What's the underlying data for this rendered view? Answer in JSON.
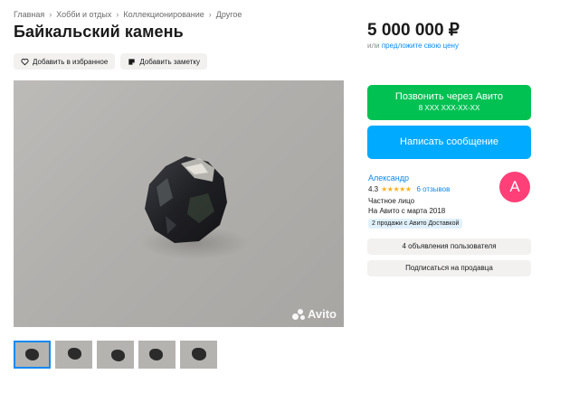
{
  "breadcrumb": [
    "Главная",
    "Хобби и отдых",
    "Коллекционирование",
    "Другое"
  ],
  "title": "Байкальский камень",
  "actions": {
    "favorite_label": "Добавить в избранное",
    "note_label": "Добавить заметку"
  },
  "price": {
    "value": "5 000 000 ₽",
    "or_label": "или",
    "offer_link": "предложите свою цену"
  },
  "watermark": "Avito",
  "thumbnails": {
    "count": 5,
    "active_index": 0
  },
  "contact": {
    "call_label": "Позвонить через Авито",
    "phone_masked": "8 XXX XXX-XX-XX",
    "message_label": "Написать сообщение"
  },
  "seller": {
    "name": "Александр",
    "rating": "4.3",
    "stars": "★★★★★",
    "reviews": "6 отзывов",
    "type": "Частное лицо",
    "since": "На Авито с марта 2018",
    "delivery_badge": "2 продажи с Авито Доставкой",
    "avatar_letter": "А",
    "avatar_color": "#ff3f78"
  },
  "seller_buttons": {
    "ads_label": "4 объявления пользователя",
    "subscribe_label": "Подписаться на продавца"
  },
  "colors": {
    "call_button": "#00c152",
    "message_button": "#00aaff",
    "link": "#0a8af0",
    "star": "#ffb021"
  }
}
